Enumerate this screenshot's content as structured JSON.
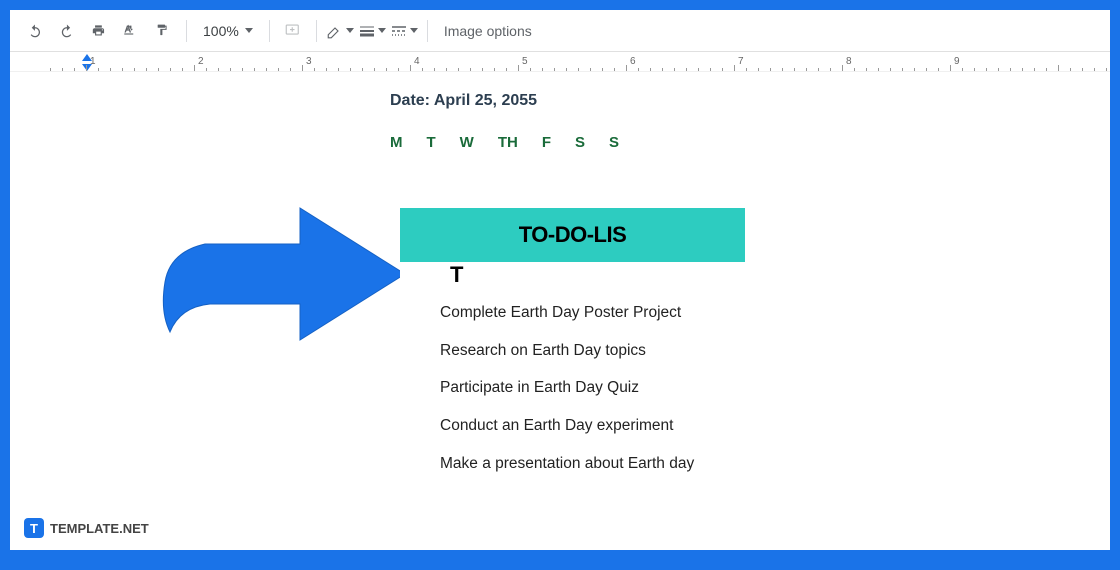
{
  "toolbar": {
    "zoom": "100%",
    "image_options": "Image options"
  },
  "ruler": {
    "numbers": [
      "1",
      "2",
      "3",
      "4",
      "5",
      "6",
      "7",
      "8",
      "9"
    ]
  },
  "document": {
    "date_label": "Date: April 25, 2055",
    "days": [
      "M",
      "T",
      "W",
      "TH",
      "F",
      "S",
      "S"
    ],
    "todo": {
      "header_line1": "TO-DO-LIS",
      "header_line2": "T",
      "items": [
        "Complete Earth Day Poster Project",
        "Research on Earth Day topics",
        "Participate in Earth Day Quiz",
        "Conduct an Earth Day experiment",
        "Make a presentation about Earth day"
      ]
    }
  },
  "watermark": {
    "icon": "T",
    "text": "TEMPLATE.NET"
  },
  "colors": {
    "frame": "#1a73e8",
    "todo_header": "#2dccc0",
    "arrow": "#1a73e8",
    "days": "#1a6b3a"
  }
}
